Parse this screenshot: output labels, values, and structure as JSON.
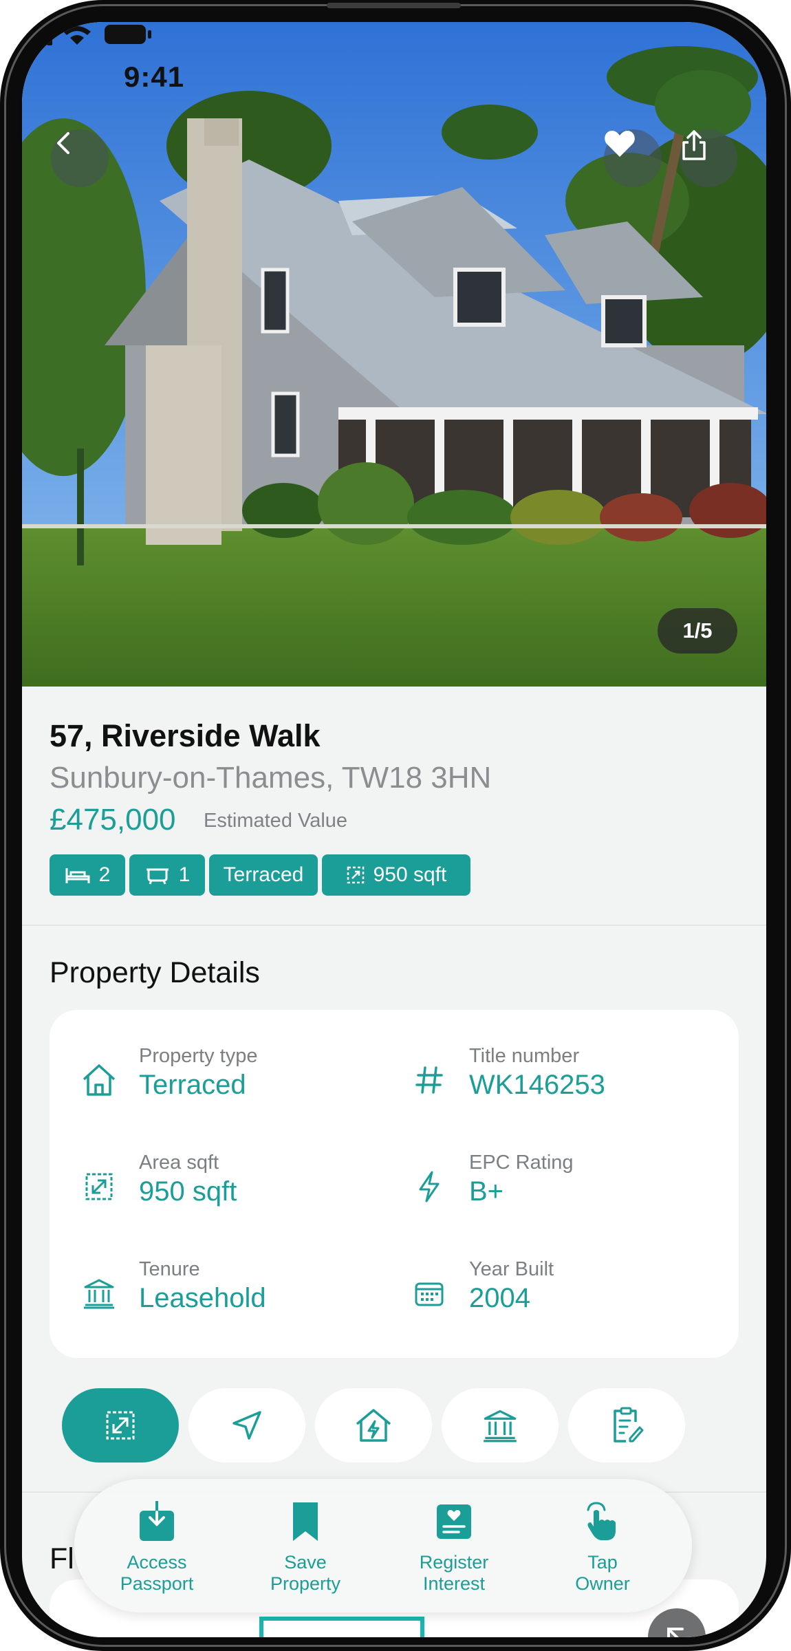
{
  "status_bar": {
    "time": "9:41"
  },
  "hero": {
    "photo_counter": "1/5"
  },
  "property": {
    "title": "57, Riverside Walk",
    "location": "Sunbury-on-Thames, TW18 3HN",
    "price": "£475,000",
    "price_note": "Estimated Value",
    "chips": {
      "beds": "2",
      "baths": "1",
      "type": "Terraced",
      "area": "950 sqft"
    }
  },
  "details": {
    "section_title": "Property Details",
    "items": [
      {
        "label": "Property type",
        "value": "Terraced",
        "icon": "house-icon"
      },
      {
        "label": "Title number",
        "value": "WK146253",
        "icon": "hash-icon"
      },
      {
        "label": "Area sqft",
        "value": "950 sqft",
        "icon": "area-icon"
      },
      {
        "label": "EPC Rating",
        "value": "B+",
        "icon": "lightning-icon"
      },
      {
        "label": "Tenure",
        "value": "Leasehold",
        "icon": "bank-icon"
      },
      {
        "label": "Year Built",
        "value": "2004",
        "icon": "calendar-icon"
      }
    ]
  },
  "tabs": [
    {
      "icon": "area-icon",
      "active": true
    },
    {
      "icon": "navigation-icon",
      "active": false
    },
    {
      "icon": "house-energy-icon",
      "active": false
    },
    {
      "icon": "bank-icon",
      "active": false
    },
    {
      "icon": "clipboard-edit-icon",
      "active": false
    }
  ],
  "next_section": {
    "title_partial": "Fl"
  },
  "actions": [
    {
      "line1": "Access",
      "line2": "Passport",
      "icon": "download-icon"
    },
    {
      "line1": "Save",
      "line2": "Property",
      "icon": "bookmark-icon"
    },
    {
      "line1": "Register",
      "line2": "Interest",
      "icon": "heart-card-icon"
    },
    {
      "line1": "Tap",
      "line2": "Owner",
      "icon": "tap-hand-icon"
    }
  ],
  "colors": {
    "accent": "#1a9e97",
    "background": "#f2f3f3",
    "card": "#ffffff"
  }
}
